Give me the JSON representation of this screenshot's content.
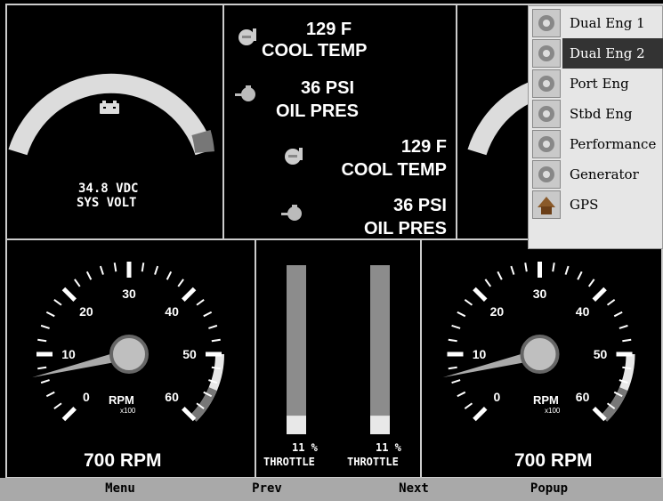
{
  "top_left": {
    "voltage_value": "34.8 VDC",
    "voltage_label": "SYS VOLT",
    "icon": "battery-icon",
    "level_fraction": 0.95
  },
  "center_readouts": {
    "eng1": {
      "cool_value": "129 F",
      "cool_label": "COOL TEMP",
      "oil_value": "36 PSI",
      "oil_label": "OIL PRES"
    },
    "eng2": {
      "cool_value": "129 F",
      "cool_label": "COOL TEMP",
      "oil_value": "36 PSI",
      "oil_label": "OIL PRES"
    }
  },
  "tachs": [
    {
      "ticks": [
        "0",
        "10",
        "20",
        "30",
        "40",
        "50",
        "60"
      ],
      "unit": "RPM",
      "multiplier": "x100",
      "reading": "700 RPM",
      "rpm_x100": 7
    },
    {
      "ticks": [
        "0",
        "10",
        "20",
        "30",
        "40",
        "50",
        "60"
      ],
      "unit": "RPM",
      "multiplier": "x100",
      "reading": "700 RPM",
      "rpm_x100": 7
    }
  ],
  "throttles": [
    {
      "value": "11 %",
      "label": "THROTTLE",
      "percent": 11
    },
    {
      "value": "11 %",
      "label": "THROTTLE",
      "percent": 11
    }
  ],
  "popup_menu": {
    "items": [
      {
        "label": "Dual Eng 1",
        "icon": "engine-icon",
        "selected": false
      },
      {
        "label": "Dual Eng 2",
        "icon": "engine-icon",
        "selected": true
      },
      {
        "label": "Port Eng",
        "icon": "engine-icon",
        "selected": false
      },
      {
        "label": "Stbd Eng",
        "icon": "engine-icon",
        "selected": false
      },
      {
        "label": "Performance",
        "icon": "engine-icon",
        "selected": false
      },
      {
        "label": "Generator",
        "icon": "engine-icon",
        "selected": false
      },
      {
        "label": "GPS",
        "icon": "gps-icon",
        "selected": false
      }
    ]
  },
  "softkeys": {
    "menu": "Menu",
    "prev": "Prev",
    "next": "Next",
    "popup": "Popup"
  },
  "colors": {
    "gauge_arc": "#dcdcdc",
    "gauge_red_zone": "#777777",
    "throttle_bar": "#8c8c8c",
    "throttle_fill": "#e8e8e8"
  }
}
